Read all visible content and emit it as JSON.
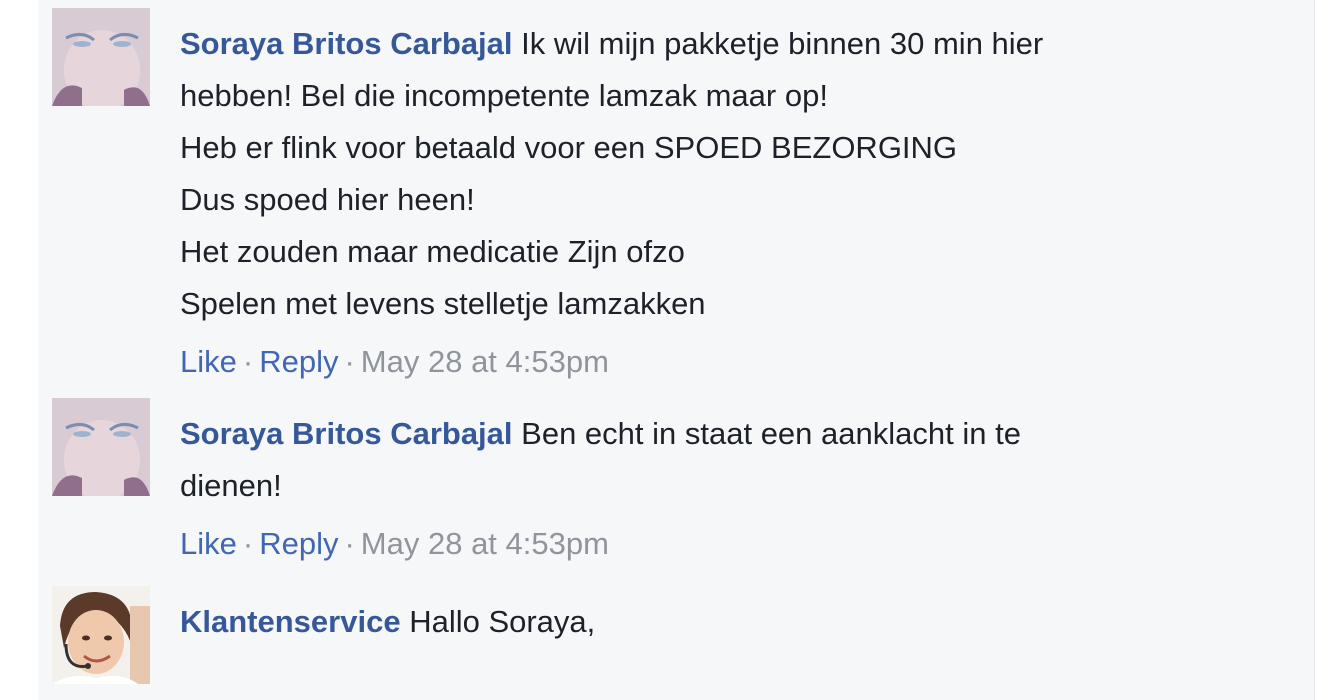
{
  "comments": [
    {
      "author": "Soraya Britos Carbajal",
      "lines": [
        "Ik wil mijn pakketje binnen 30 min hier",
        "hebben! Bel die incompetente lamzak maar op!",
        "Heb er flink voor betaald voor een SPOED BEZORGING",
        "Dus spoed hier heen!",
        "Het zouden maar medicatie Zijn ofzo",
        "Spelen met levens stelletje lamzakken"
      ],
      "like": "Like",
      "reply": "Reply",
      "separator": "·",
      "timestamp": "May 28 at 4:53pm",
      "avatar_icon": "user-avatar-photo"
    },
    {
      "author": "Soraya Britos Carbajal",
      "lines": [
        "Ben echt in staat een aanklacht in te",
        "dienen!"
      ],
      "like": "Like",
      "reply": "Reply",
      "separator": "·",
      "timestamp": "May 28 at 4:53pm",
      "avatar_icon": "user-avatar-photo"
    },
    {
      "author": "Klantenservice",
      "lines": [
        "Hallo Soraya,"
      ],
      "avatar_icon": "support-agent-avatar-photo"
    }
  ],
  "colors": {
    "background": "#f6f7f9",
    "author_link": "#365899",
    "action_link": "#4267b2",
    "meta_text": "#90949c",
    "body_text": "#1d2129"
  }
}
